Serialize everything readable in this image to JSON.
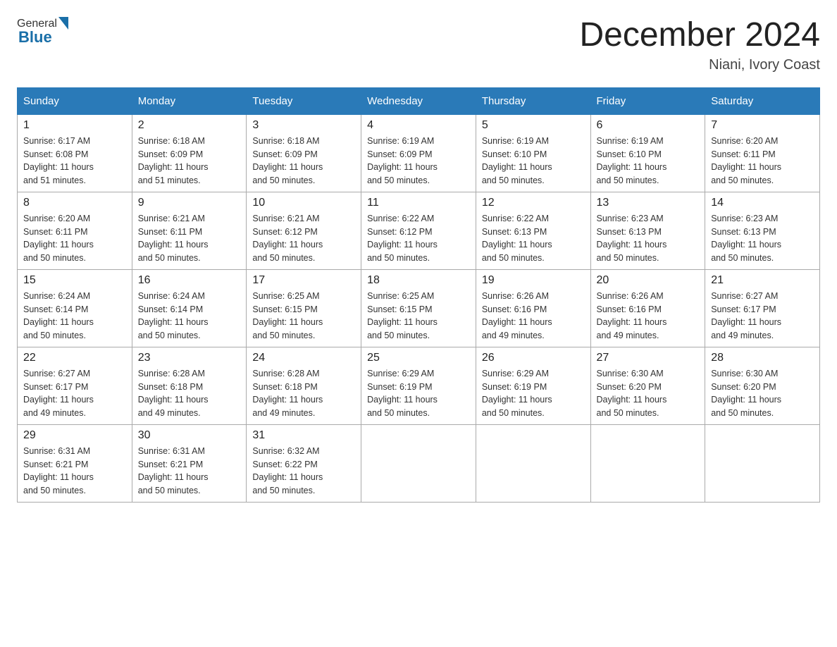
{
  "logo": {
    "general": "General",
    "blue": "Blue"
  },
  "title": "December 2024",
  "location": "Niani, Ivory Coast",
  "weekdays": [
    "Sunday",
    "Monday",
    "Tuesday",
    "Wednesday",
    "Thursday",
    "Friday",
    "Saturday"
  ],
  "weeks": [
    [
      {
        "day": "1",
        "sunrise": "6:17 AM",
        "sunset": "6:08 PM",
        "daylight": "11 hours and 51 minutes."
      },
      {
        "day": "2",
        "sunrise": "6:18 AM",
        "sunset": "6:09 PM",
        "daylight": "11 hours and 51 minutes."
      },
      {
        "day": "3",
        "sunrise": "6:18 AM",
        "sunset": "6:09 PM",
        "daylight": "11 hours and 50 minutes."
      },
      {
        "day": "4",
        "sunrise": "6:19 AM",
        "sunset": "6:09 PM",
        "daylight": "11 hours and 50 minutes."
      },
      {
        "day": "5",
        "sunrise": "6:19 AM",
        "sunset": "6:10 PM",
        "daylight": "11 hours and 50 minutes."
      },
      {
        "day": "6",
        "sunrise": "6:19 AM",
        "sunset": "6:10 PM",
        "daylight": "11 hours and 50 minutes."
      },
      {
        "day": "7",
        "sunrise": "6:20 AM",
        "sunset": "6:11 PM",
        "daylight": "11 hours and 50 minutes."
      }
    ],
    [
      {
        "day": "8",
        "sunrise": "6:20 AM",
        "sunset": "6:11 PM",
        "daylight": "11 hours and 50 minutes."
      },
      {
        "day": "9",
        "sunrise": "6:21 AM",
        "sunset": "6:11 PM",
        "daylight": "11 hours and 50 minutes."
      },
      {
        "day": "10",
        "sunrise": "6:21 AM",
        "sunset": "6:12 PM",
        "daylight": "11 hours and 50 minutes."
      },
      {
        "day": "11",
        "sunrise": "6:22 AM",
        "sunset": "6:12 PM",
        "daylight": "11 hours and 50 minutes."
      },
      {
        "day": "12",
        "sunrise": "6:22 AM",
        "sunset": "6:13 PM",
        "daylight": "11 hours and 50 minutes."
      },
      {
        "day": "13",
        "sunrise": "6:23 AM",
        "sunset": "6:13 PM",
        "daylight": "11 hours and 50 minutes."
      },
      {
        "day": "14",
        "sunrise": "6:23 AM",
        "sunset": "6:13 PM",
        "daylight": "11 hours and 50 minutes."
      }
    ],
    [
      {
        "day": "15",
        "sunrise": "6:24 AM",
        "sunset": "6:14 PM",
        "daylight": "11 hours and 50 minutes."
      },
      {
        "day": "16",
        "sunrise": "6:24 AM",
        "sunset": "6:14 PM",
        "daylight": "11 hours and 50 minutes."
      },
      {
        "day": "17",
        "sunrise": "6:25 AM",
        "sunset": "6:15 PM",
        "daylight": "11 hours and 50 minutes."
      },
      {
        "day": "18",
        "sunrise": "6:25 AM",
        "sunset": "6:15 PM",
        "daylight": "11 hours and 50 minutes."
      },
      {
        "day": "19",
        "sunrise": "6:26 AM",
        "sunset": "6:16 PM",
        "daylight": "11 hours and 49 minutes."
      },
      {
        "day": "20",
        "sunrise": "6:26 AM",
        "sunset": "6:16 PM",
        "daylight": "11 hours and 49 minutes."
      },
      {
        "day": "21",
        "sunrise": "6:27 AM",
        "sunset": "6:17 PM",
        "daylight": "11 hours and 49 minutes."
      }
    ],
    [
      {
        "day": "22",
        "sunrise": "6:27 AM",
        "sunset": "6:17 PM",
        "daylight": "11 hours and 49 minutes."
      },
      {
        "day": "23",
        "sunrise": "6:28 AM",
        "sunset": "6:18 PM",
        "daylight": "11 hours and 49 minutes."
      },
      {
        "day": "24",
        "sunrise": "6:28 AM",
        "sunset": "6:18 PM",
        "daylight": "11 hours and 49 minutes."
      },
      {
        "day": "25",
        "sunrise": "6:29 AM",
        "sunset": "6:19 PM",
        "daylight": "11 hours and 50 minutes."
      },
      {
        "day": "26",
        "sunrise": "6:29 AM",
        "sunset": "6:19 PM",
        "daylight": "11 hours and 50 minutes."
      },
      {
        "day": "27",
        "sunrise": "6:30 AM",
        "sunset": "6:20 PM",
        "daylight": "11 hours and 50 minutes."
      },
      {
        "day": "28",
        "sunrise": "6:30 AM",
        "sunset": "6:20 PM",
        "daylight": "11 hours and 50 minutes."
      }
    ],
    [
      {
        "day": "29",
        "sunrise": "6:31 AM",
        "sunset": "6:21 PM",
        "daylight": "11 hours and 50 minutes."
      },
      {
        "day": "30",
        "sunrise": "6:31 AM",
        "sunset": "6:21 PM",
        "daylight": "11 hours and 50 minutes."
      },
      {
        "day": "31",
        "sunrise": "6:32 AM",
        "sunset": "6:22 PM",
        "daylight": "11 hours and 50 minutes."
      },
      null,
      null,
      null,
      null
    ]
  ],
  "labels": {
    "sunrise": "Sunrise:",
    "sunset": "Sunset:",
    "daylight": "Daylight:"
  }
}
